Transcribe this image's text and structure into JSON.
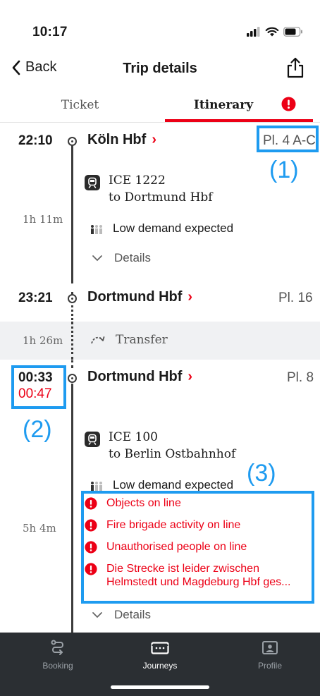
{
  "status_bar": {
    "time": "10:17"
  },
  "nav": {
    "back_label": "Back",
    "title": "Trip details"
  },
  "tabs": [
    {
      "label": "Ticket"
    },
    {
      "label": "Itinerary",
      "active": true
    }
  ],
  "itinerary": {
    "leg1": {
      "departure_time": "22:10",
      "departure_station": "Köln Hbf",
      "departure_platform": "Pl. 4 A-C",
      "train_name": "ICE 1222",
      "train_destination": "to Dortmund Hbf",
      "duration": "1h 11m",
      "demand": "Low demand expected",
      "details_label": "Details",
      "arrival_time": "23:21",
      "arrival_station": "Dortmund Hbf",
      "arrival_platform": "Pl. 16"
    },
    "transfer": {
      "duration": "1h 26m",
      "label": "Transfer"
    },
    "leg2": {
      "departure_time": "00:33",
      "departure_time_actual": "00:47",
      "departure_station": "Dortmund Hbf",
      "departure_platform": "Pl. 8",
      "train_name": "ICE 100",
      "train_destination": "to Berlin Ostbahnhof",
      "duration": "5h 4m",
      "demand": "Low demand expected",
      "alerts": [
        "Objects on line",
        "Fire brigade activity on line",
        "Unauthorised people on line",
        "Die Strecke ist leider zwischen Helmstedt und Magdeburg Hbf ges..."
      ],
      "details_label": "Details"
    }
  },
  "annotations": {
    "a1": "(1)",
    "a2": "(2)",
    "a3": "(3)"
  },
  "bottom_nav": [
    {
      "label": "Booking",
      "icon": "route-icon"
    },
    {
      "label": "Journeys",
      "icon": "ticket-icon",
      "active": true
    },
    {
      "label": "Profile",
      "icon": "profile-icon"
    }
  ],
  "colors": {
    "accent": "#ec0016",
    "annotation": "#1e9bf0",
    "tabbar": "#2b2f33"
  }
}
